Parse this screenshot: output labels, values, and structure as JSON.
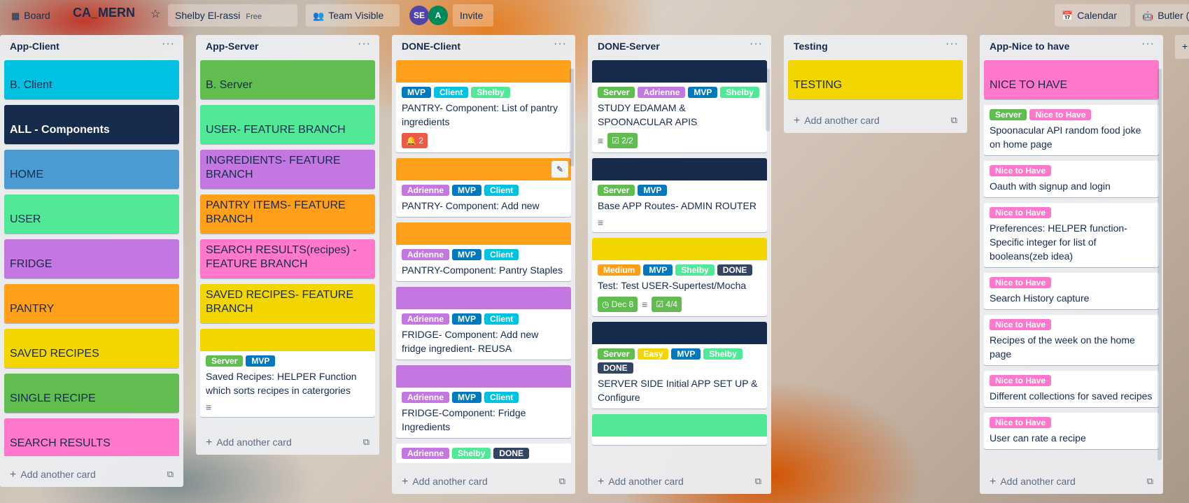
{
  "header": {
    "board_btn": "Board",
    "board_title": "CA_MERN",
    "star": "☆",
    "user": "Shelby El-rassi",
    "free": "Free",
    "visibility": "Team Visible",
    "avatars": [
      {
        "initials": "SE",
        "color": "#5243aa"
      },
      {
        "initials": "A",
        "color": "#00875a"
      }
    ],
    "invite": "Invite",
    "calendar": "Calendar",
    "butler": "Butler (",
    "plus": "+"
  },
  "colors": {
    "green": "#61bd4f",
    "yellow": "#f2d600",
    "orange": "#ff9f1a",
    "red": "#eb5a46",
    "purple": "#c377e0",
    "blue": "#0079bf",
    "sky": "#00c2e0",
    "lime": "#51e898",
    "pink": "#ff78cb",
    "black": "#344563",
    "navy": "#172b4d"
  },
  "lists": [
    {
      "title": "App-Client",
      "add_label": "Add another card",
      "cards": [
        {
          "type": "colored",
          "bg": "#00c2e0",
          "title": "B. Client"
        },
        {
          "type": "colored",
          "bg": "#172b4d",
          "title": "ALL - Components",
          "fg": "#fff",
          "bold": true
        },
        {
          "type": "colored",
          "bg": "#4a9bd1",
          "title": "HOME"
        },
        {
          "type": "colored",
          "bg": "#51e898",
          "title": "USER"
        },
        {
          "type": "colored",
          "bg": "#c377e0",
          "title": "FRIDGE"
        },
        {
          "type": "colored",
          "bg": "#ff9f1a",
          "title": "PANTRY"
        },
        {
          "type": "colored",
          "bg": "#f2d600",
          "title": "SAVED RECIPES"
        },
        {
          "type": "colored",
          "bg": "#61bd4f",
          "title": "SINGLE RECIPE"
        },
        {
          "type": "colored",
          "bg": "#ff78cb",
          "title": "SEARCH RESULTS"
        }
      ]
    },
    {
      "title": "App-Server",
      "add_label": "Add another card",
      "cards": [
        {
          "type": "colored",
          "bg": "#61bd4f",
          "title": "B. Server"
        },
        {
          "type": "colored",
          "bg": "#51e898",
          "title": "USER- FEATURE BRANCH"
        },
        {
          "type": "colored",
          "bg": "#c377e0",
          "title": "INGREDIENTS- FEATURE BRANCH"
        },
        {
          "type": "colored",
          "bg": "#ff9f1a",
          "title": "PANTRY ITEMS- FEATURE BRANCH"
        },
        {
          "type": "colored",
          "bg": "#ff78cb",
          "title": "SEARCH RESULTS(recipes) - FEATURE BRANCH"
        },
        {
          "type": "colored",
          "bg": "#f2d600",
          "title": "SAVED RECIPES- FEATURE BRANCH"
        },
        {
          "type": "normal",
          "cover": "#f2d600",
          "labels": [
            [
              "Server",
              "#61bd4f"
            ],
            [
              "MVP",
              "#0079bf"
            ]
          ],
          "text": "Saved Recipes: HELPER Function which sorts recipes in catergories",
          "badges": [
            {
              "kind": "desc"
            }
          ]
        }
      ]
    },
    {
      "title": "DONE-Client",
      "add_label": "Add another card",
      "cards": [
        {
          "type": "normal",
          "cover": "#ff9f1a",
          "labels": [
            [
              "MVP",
              "#0079bf"
            ],
            [
              "Client",
              "#00c2e0"
            ],
            [
              "Shelby",
              "#51e898"
            ]
          ],
          "text": "PANTRY- Component: List of pantry ingredients",
          "badges": [
            {
              "kind": "alert",
              "text": "2"
            }
          ]
        },
        {
          "type": "normal",
          "cover": "#ff9f1a",
          "edit": true,
          "labels": [
            [
              "Adrienne",
              "#c377e0"
            ],
            [
              "MVP",
              "#0079bf"
            ],
            [
              "Client",
              "#00c2e0"
            ]
          ],
          "text": "PANTRY- Component: Add new",
          "badges": []
        },
        {
          "type": "normal",
          "cover": "#ff9f1a",
          "labels": [
            [
              "Adrienne",
              "#c377e0"
            ],
            [
              "MVP",
              "#0079bf"
            ],
            [
              "Client",
              "#00c2e0"
            ]
          ],
          "text": "PANTRY-Component: Pantry Staples",
          "badges": []
        },
        {
          "type": "normal",
          "cover": "#c377e0",
          "labels": [
            [
              "Adrienne",
              "#c377e0"
            ],
            [
              "MVP",
              "#0079bf"
            ],
            [
              "Client",
              "#00c2e0"
            ]
          ],
          "text": "FRIDGE- Component: Add new fridge ingredient- REUSA",
          "badges": []
        },
        {
          "type": "normal",
          "cover": "#c377e0",
          "labels": [
            [
              "Adrienne",
              "#c377e0"
            ],
            [
              "MVP",
              "#0079bf"
            ],
            [
              "Client",
              "#00c2e0"
            ]
          ],
          "text": "FRIDGE-Component: Fridge Ingredients",
          "badges": []
        },
        {
          "type": "normal",
          "cover": "",
          "labels": [
            [
              "Adrienne",
              "#c377e0"
            ],
            [
              "Shelby",
              "#51e898"
            ],
            [
              "DONE",
              "#344563"
            ]
          ],
          "text": "",
          "badges": []
        }
      ]
    },
    {
      "title": "DONE-Server",
      "add_label": "Add another card",
      "cards": [
        {
          "type": "normal",
          "cover": "#172b4d",
          "labels": [
            [
              "Server",
              "#61bd4f"
            ],
            [
              "Adrienne",
              "#c377e0"
            ],
            [
              "MVP",
              "#0079bf"
            ],
            [
              "Shelby",
              "#51e898"
            ]
          ],
          "text": "STUDY EDAMAM & SPOONACULAR APIS",
          "badges": [
            {
              "kind": "desc"
            },
            {
              "kind": "check",
              "text": "2/2"
            }
          ]
        },
        {
          "type": "normal",
          "cover": "#172b4d",
          "labels": [
            [
              "Server",
              "#61bd4f"
            ],
            [
              "MVP",
              "#0079bf"
            ]
          ],
          "text": "Base APP Routes- ADMIN ROUTER",
          "badges": [
            {
              "kind": "desc"
            }
          ]
        },
        {
          "type": "normal",
          "cover": "#f2d600",
          "labels": [
            [
              "Medium",
              "#ff9f1a"
            ],
            [
              "MVP",
              "#0079bf"
            ],
            [
              "Shelby",
              "#51e898"
            ],
            [
              "DONE",
              "#344563"
            ]
          ],
          "text": "Test: Test USER-Supertest/Mocha",
          "badges": [
            {
              "kind": "date",
              "text": "Dec 8"
            },
            {
              "kind": "desc"
            },
            {
              "kind": "check",
              "text": "4/4"
            }
          ]
        },
        {
          "type": "normal",
          "cover": "#172b4d",
          "labels": [
            [
              "Server",
              "#61bd4f"
            ],
            [
              "Easy",
              "#f2d600"
            ],
            [
              "MVP",
              "#0079bf"
            ],
            [
              "Shelby",
              "#51e898"
            ],
            [
              "DONE",
              "#344563"
            ]
          ],
          "text": "SERVER SIDE Initial APP SET UP & Configure",
          "badges": []
        },
        {
          "type": "normal",
          "cover": "#51e898",
          "labels": [],
          "text": "",
          "badges": []
        }
      ]
    },
    {
      "title": "Testing",
      "add_label": "Add another card",
      "cards": [
        {
          "type": "colored",
          "bg": "#f2d600",
          "title": "TESTING"
        }
      ]
    },
    {
      "title": "App-Nice to have",
      "add_label": "Add another card",
      "cards": [
        {
          "type": "colored",
          "bg": "#ff78cb",
          "title": "NICE TO HAVE"
        },
        {
          "type": "normal",
          "cover": "",
          "labels": [
            [
              "Server",
              "#61bd4f"
            ],
            [
              "Nice to Have",
              "#ff78cb"
            ]
          ],
          "text": "Spoonacular API random food joke on home page",
          "badges": []
        },
        {
          "type": "normal",
          "cover": "",
          "labels": [
            [
              "Nice to Have",
              "#ff78cb"
            ]
          ],
          "text": "Oauth with signup and login",
          "badges": []
        },
        {
          "type": "normal",
          "cover": "",
          "labels": [
            [
              "Nice to Have",
              "#ff78cb"
            ]
          ],
          "text": "Preferences: HELPER function- Specific integer for list of booleans(zeb idea)",
          "badges": []
        },
        {
          "type": "normal",
          "cover": "",
          "labels": [
            [
              "Nice to Have",
              "#ff78cb"
            ]
          ],
          "text": "Search History capture",
          "badges": []
        },
        {
          "type": "normal",
          "cover": "",
          "labels": [
            [
              "Nice to Have",
              "#ff78cb"
            ]
          ],
          "text": "Recipes of the week on the home page",
          "badges": []
        },
        {
          "type": "normal",
          "cover": "",
          "labels": [
            [
              "Nice to Have",
              "#ff78cb"
            ]
          ],
          "text": "Different collections for saved recipes",
          "badges": []
        },
        {
          "type": "normal",
          "cover": "",
          "labels": [
            [
              "Nice to Have",
              "#ff78cb"
            ]
          ],
          "text": "User can rate a recipe",
          "badges": []
        }
      ]
    }
  ]
}
